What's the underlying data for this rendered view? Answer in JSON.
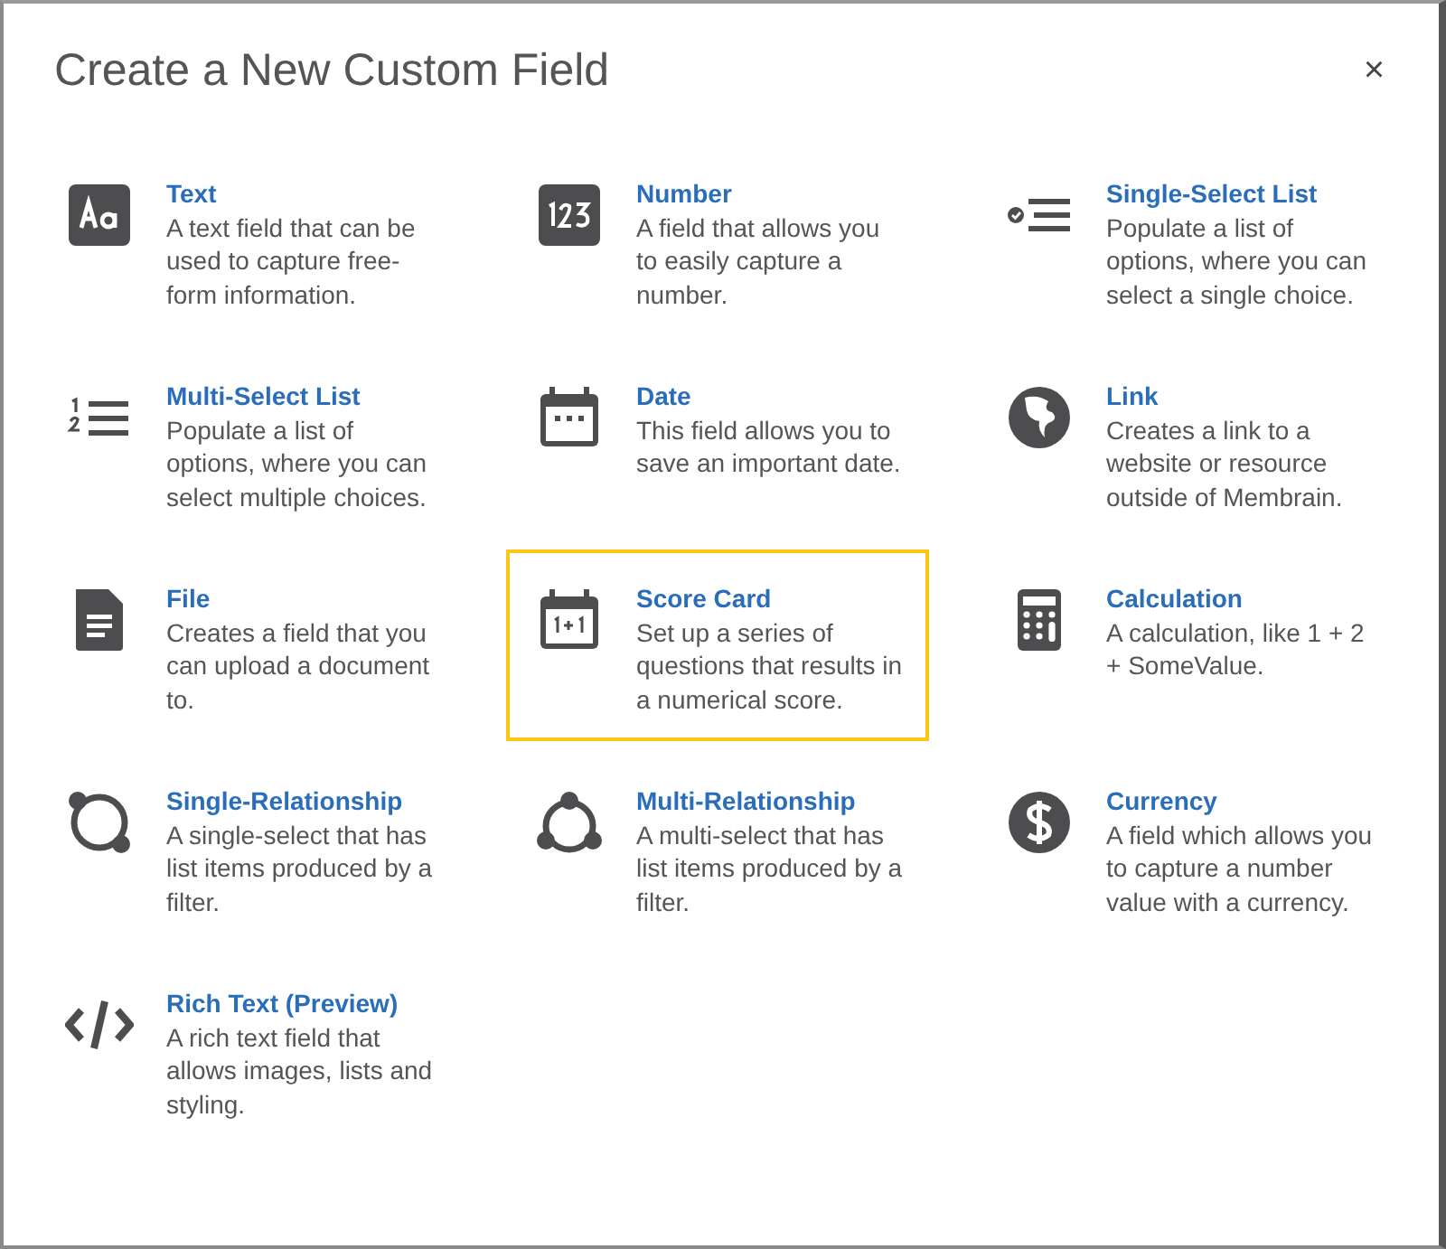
{
  "dialog": {
    "title": "Create a New Custom Field",
    "close": "×"
  },
  "field_types": [
    {
      "kind": "text",
      "title": "Text",
      "description": "A text field that can be used to capture free-form information.",
      "selected": false
    },
    {
      "kind": "number",
      "title": "Number",
      "description": "A field that allows you to easily capture a number.",
      "selected": false
    },
    {
      "kind": "singleselect",
      "title": "Single-Select List",
      "description": "Populate a list of options, where you can select a single choice.",
      "selected": false
    },
    {
      "kind": "multiselect",
      "title": "Multi-Select List",
      "description": "Populate a list of options, where you can select multiple choices.",
      "selected": false
    },
    {
      "kind": "date",
      "title": "Date",
      "description": "This field allows you to save an important date.",
      "selected": false
    },
    {
      "kind": "link",
      "title": "Link",
      "description": "Creates a link to a website or resource outside of Membrain.",
      "selected": false
    },
    {
      "kind": "file",
      "title": "File",
      "description": "Creates a field that you can upload a document to.",
      "selected": false
    },
    {
      "kind": "scorecard",
      "title": "Score Card",
      "description": "Set up a series of questions that results in a numerical score.",
      "selected": true
    },
    {
      "kind": "calculation",
      "title": "Calculation",
      "description": "A calculation, like 1 + 2 + SomeValue.",
      "selected": false
    },
    {
      "kind": "singlerelationship",
      "title": "Single-Relationship",
      "description": "A single-select that has list items produced by a filter.",
      "selected": false
    },
    {
      "kind": "multirelationship",
      "title": "Multi-Relationship",
      "description": "A multi-select that has list items produced by a filter.",
      "selected": false
    },
    {
      "kind": "currency",
      "title": "Currency",
      "description": "A field which allows you to capture a number value with a currency.",
      "selected": false
    },
    {
      "kind": "richtext",
      "title": "Rich Text (Preview)",
      "description": "A rich text field that allows images, lists and styling.",
      "selected": false
    }
  ]
}
